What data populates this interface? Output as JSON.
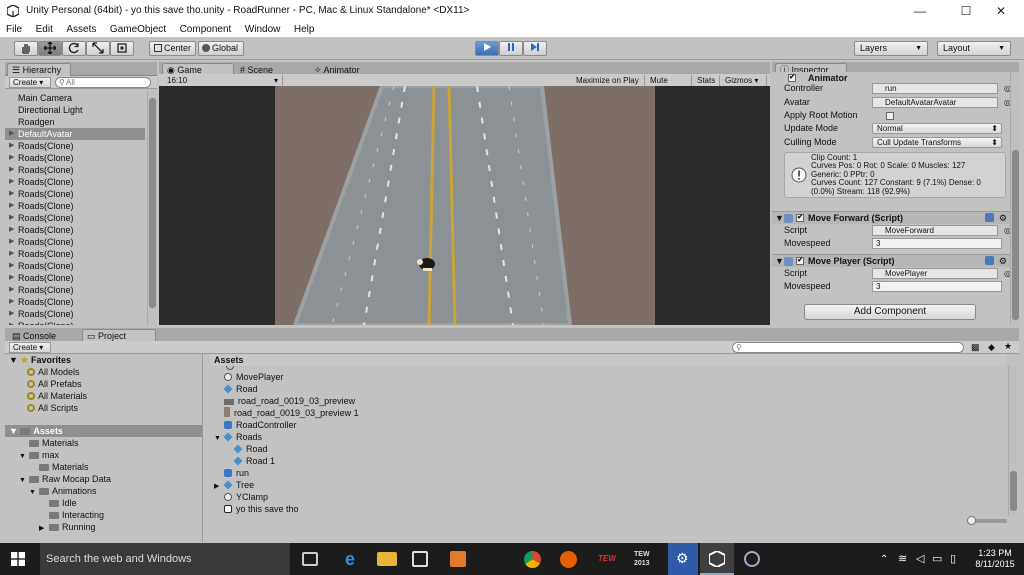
{
  "window": {
    "title": "Unity Personal (64bit) - yo this save tho.unity - RoadRunner - PC, Mac & Linux Standalone* <DX11>",
    "minimize": "—",
    "maximize": "☐",
    "close": "✕"
  },
  "menu": [
    "File",
    "Edit",
    "Assets",
    "GameObject",
    "Component",
    "Window",
    "Help"
  ],
  "toolbar": {
    "pivot": "Center",
    "space": "Global",
    "layers": "Layers",
    "layout": "Layout"
  },
  "hierarchy": {
    "tab": "Hierarchy",
    "create": "Create",
    "search_placeholder": "All",
    "items": [
      {
        "label": "Main Camera",
        "expandable": false,
        "selected": false
      },
      {
        "label": "Directional Light",
        "expandable": false,
        "selected": false
      },
      {
        "label": "Roadgen",
        "expandable": false,
        "selected": false
      },
      {
        "label": "DefaultAvatar",
        "expandable": true,
        "selected": true
      },
      {
        "label": "Roads(Clone)",
        "expandable": true,
        "selected": false
      },
      {
        "label": "Roads(Clone)",
        "expandable": true,
        "selected": false
      },
      {
        "label": "Roads(Clone)",
        "expandable": true,
        "selected": false
      },
      {
        "label": "Roads(Clone)",
        "expandable": true,
        "selected": false
      },
      {
        "label": "Roads(Clone)",
        "expandable": true,
        "selected": false
      },
      {
        "label": "Roads(Clone)",
        "expandable": true,
        "selected": false
      },
      {
        "label": "Roads(Clone)",
        "expandable": true,
        "selected": false
      },
      {
        "label": "Roads(Clone)",
        "expandable": true,
        "selected": false
      },
      {
        "label": "Roads(Clone)",
        "expandable": true,
        "selected": false
      },
      {
        "label": "Roads(Clone)",
        "expandable": true,
        "selected": false
      },
      {
        "label": "Roads(Clone)",
        "expandable": true,
        "selected": false
      },
      {
        "label": "Roads(Clone)",
        "expandable": true,
        "selected": false
      },
      {
        "label": "Roads(Clone)",
        "expandable": true,
        "selected": false
      },
      {
        "label": "Roads(Clone)",
        "expandable": true,
        "selected": false
      },
      {
        "label": "Roads(Clone)",
        "expandable": true,
        "selected": false
      },
      {
        "label": "Roads(Clone)",
        "expandable": true,
        "selected": false
      },
      {
        "label": "Roads(Clone)",
        "expandable": true,
        "selected": false
      },
      {
        "label": "Roads(Clone)",
        "expandable": true,
        "selected": false
      }
    ]
  },
  "views": {
    "tabs": [
      "Game",
      "Scene",
      "Animator"
    ],
    "aspect": "16:10",
    "buttons": [
      "Maximize on Play",
      "Mute audio",
      "Stats",
      "Gizmos"
    ]
  },
  "inspector": {
    "tab": "Inspector",
    "animator": {
      "header": "Animator",
      "controller_label": "Controller",
      "controller_value": "run",
      "avatar_label": "Avatar",
      "avatar_value": "DefaultAvatarAvatar",
      "root_motion_label": "Apply Root Motion",
      "update_mode_label": "Update Mode",
      "update_mode_value": "Normal",
      "culling_mode_label": "Culling Mode",
      "culling_mode_value": "Cull Update Transforms",
      "info_lines": [
        "Clip Count: 1",
        "Curves Pos: 0 Rot: 0 Scale: 0 Muscles: 127",
        "Generic: 0 PPtr: 0",
        "Curves Count: 127 Constant: 9 (7.1%) Dense: 0",
        "(0.0%) Stream: 118 (92.9%)"
      ]
    },
    "move_forward": {
      "header": "Move Forward (Script)",
      "script_label": "Script",
      "script_value": "MoveForward",
      "speed_label": "Movespeed",
      "speed_value": "3"
    },
    "move_player": {
      "header": "Move Player (Script)",
      "script_label": "Script",
      "script_value": "MovePlayer",
      "speed_label": "Movespeed",
      "speed_value": "3"
    },
    "add_component": "Add Component"
  },
  "project": {
    "tabs": [
      "Console",
      "Project"
    ],
    "create": "Create",
    "favorites_header": "Favorites",
    "favorites": [
      "All Models",
      "All Prefabs",
      "All Materials",
      "All Scripts"
    ],
    "assets_header": "Assets",
    "tree": [
      {
        "label": "Materials",
        "indent": 1,
        "arrow": ""
      },
      {
        "label": "max",
        "indent": 1,
        "arrow": "▼"
      },
      {
        "label": "Materials",
        "indent": 2,
        "arrow": ""
      },
      {
        "label": "Raw Mocap Data",
        "indent": 1,
        "arrow": "▼"
      },
      {
        "label": "Animations",
        "indent": 2,
        "arrow": "▼"
      },
      {
        "label": "Idle",
        "indent": 3,
        "arrow": ""
      },
      {
        "label": "Interacting",
        "indent": 3,
        "arrow": ""
      },
      {
        "label": "Running",
        "indent": 3,
        "arrow": "▶"
      }
    ],
    "breadcrumb": "Assets",
    "assets": [
      {
        "label": "MovePlayer",
        "icon": "script",
        "indent": 0,
        "arrow": ""
      },
      {
        "label": "Road",
        "icon": "prefab",
        "indent": 0,
        "arrow": ""
      },
      {
        "label": "road_road_0019_03_preview",
        "icon": "texture",
        "indent": 0,
        "arrow": ""
      },
      {
        "label": "road_road_0019_03_preview 1",
        "icon": "texture2",
        "indent": 0,
        "arrow": ""
      },
      {
        "label": "RoadController",
        "icon": "controller",
        "indent": 0,
        "arrow": ""
      },
      {
        "label": "Roads",
        "icon": "prefab",
        "indent": 0,
        "arrow": "▼"
      },
      {
        "label": "Road",
        "icon": "prefab",
        "indent": 1,
        "arrow": ""
      },
      {
        "label": "Road 1",
        "icon": "prefab",
        "indent": 1,
        "arrow": ""
      },
      {
        "label": "run",
        "icon": "controller",
        "indent": 0,
        "arrow": ""
      },
      {
        "label": "Tree",
        "icon": "prefab",
        "indent": 0,
        "arrow": "▶"
      },
      {
        "label": "YClamp",
        "icon": "script",
        "indent": 0,
        "arrow": ""
      },
      {
        "label": "yo this save tho",
        "icon": "unity",
        "indent": 0,
        "arrow": ""
      }
    ]
  },
  "taskbar": {
    "search_placeholder": "Search the web and Windows",
    "time": "1:23 PM",
    "date": "8/11/2015"
  },
  "colors": {
    "play_blue": "#3a6fb8",
    "selection": "#8f8f8f",
    "road": "#8c9196",
    "ground": "#7d6f67",
    "taskbar": "#1c1c1c"
  }
}
